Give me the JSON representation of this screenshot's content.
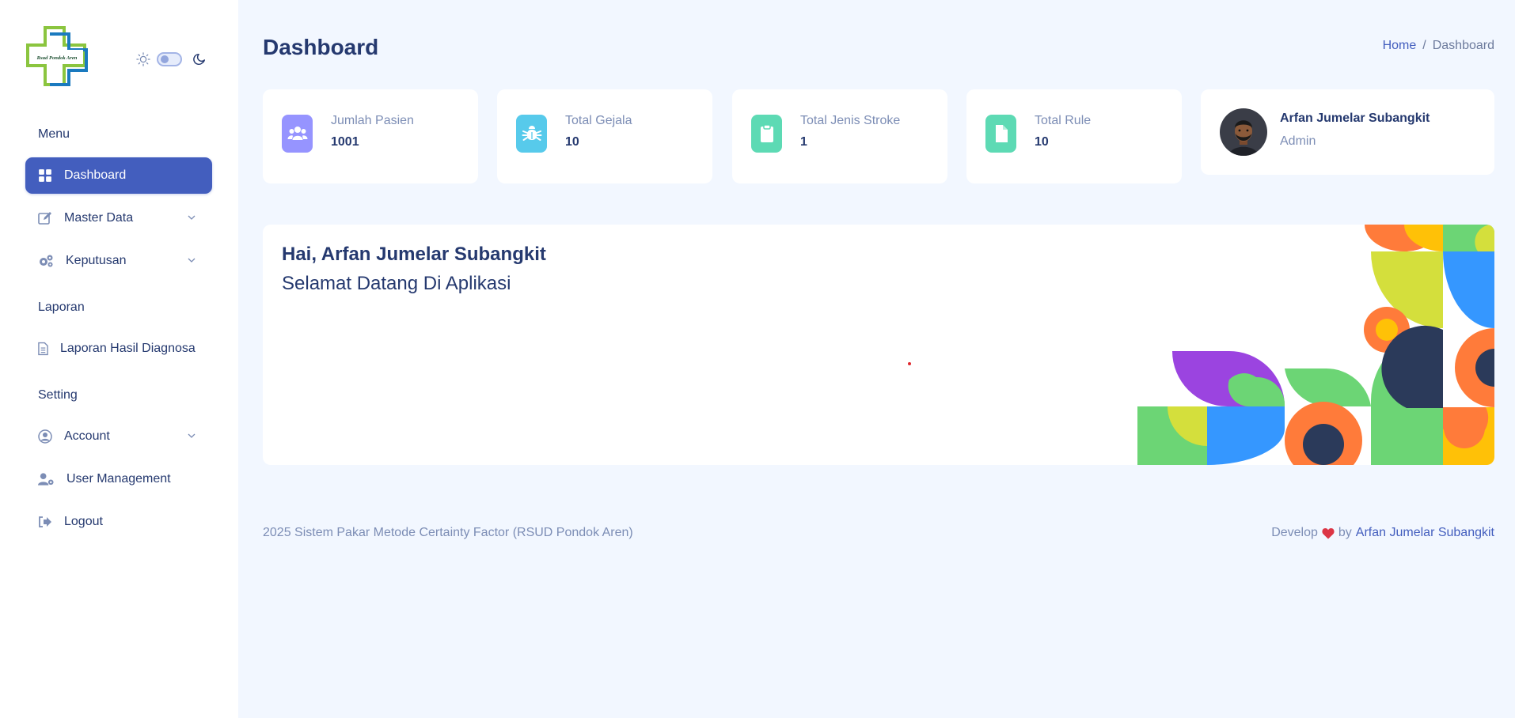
{
  "sidebar": {
    "logo_text": "Rsud Pondok Aren",
    "sections": {
      "menu": "Menu",
      "laporan": "Laporan",
      "setting": "Setting"
    },
    "items": {
      "dashboard": "Dashboard",
      "master_data": "Master Data",
      "keputusan": "Keputusan",
      "laporan_hasil": "Laporan Hasil Diagnosa",
      "account": "Account",
      "user_management": "User Management",
      "logout": "Logout"
    }
  },
  "header": {
    "title": "Dashboard",
    "breadcrumb": {
      "home": "Home",
      "separator": "/",
      "current": "Dashboard"
    }
  },
  "stats": [
    {
      "label": "Jumlah Pasien",
      "value": "1001",
      "icon": "users-icon",
      "color": "#9694ff"
    },
    {
      "label": "Total Gejala",
      "value": "10",
      "icon": "bug-icon",
      "color": "#57caeb"
    },
    {
      "label": "Total Jenis Stroke",
      "value": "1",
      "icon": "clipboard-icon",
      "color": "#5ddab4"
    },
    {
      "label": "Total Rule",
      "value": "10",
      "icon": "file-icon",
      "color": "#5ddab4"
    }
  ],
  "profile": {
    "name": "Arfan Jumelar Subangkit",
    "role": "Admin"
  },
  "welcome": {
    "greeting": "Hai, Arfan Jumelar Subangkit",
    "subtitle": "Selamat Datang Di Aplikasi"
  },
  "footer": {
    "left": "2025 Sistem Pakar Metode Certainty Factor (RSUD Pondok Aren)",
    "develop": "Develop",
    "by": "by",
    "author": "Arfan Jumelar Subangkit"
  },
  "colors": {
    "primary": "#435ebe",
    "text": "#25396f",
    "muted": "#7c8db5",
    "background": "#f2f7ff"
  }
}
